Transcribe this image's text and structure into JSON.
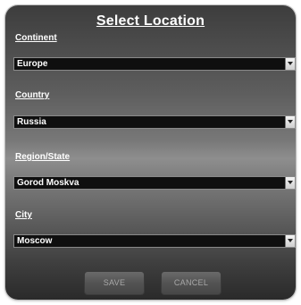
{
  "dialog": {
    "title": "Select Location",
    "fields": [
      {
        "label": "Continent",
        "value": "Europe"
      },
      {
        "label": "Country",
        "value": "Russia"
      },
      {
        "label": "Region/State",
        "value": "Gorod Moskva"
      },
      {
        "label": "City",
        "value": "Moscow"
      }
    ],
    "buttons": {
      "save": "SAVE",
      "cancel": "CANCEL"
    }
  },
  "colors": {
    "select_background": "#0f0f0f",
    "text": "#ffffff",
    "button_text": "#a8a8a8"
  },
  "icons": {
    "dropdown": "chevron-down-icon"
  }
}
